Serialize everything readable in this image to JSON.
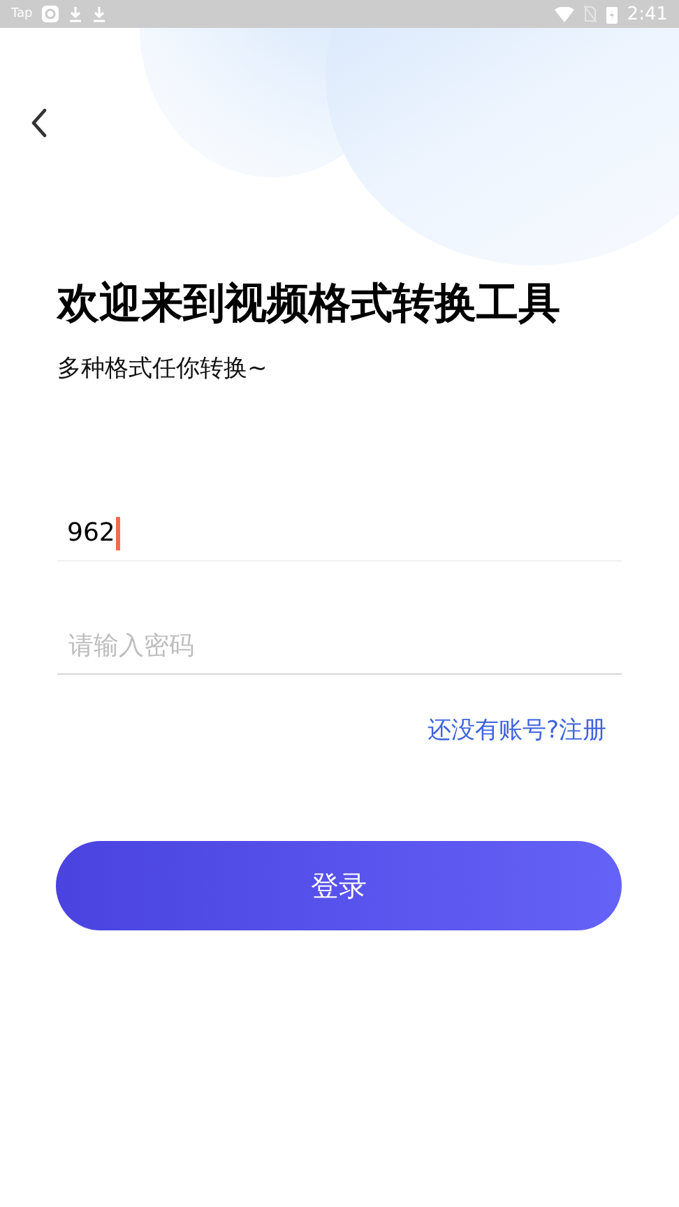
{
  "status_bar": {
    "carrier": "Tap",
    "time": "2:41"
  },
  "title": "欢迎来到视频格式转换工具",
  "subtitle": "多种格式任你转换~",
  "username": {
    "value": "962",
    "focused": true
  },
  "password": {
    "placeholder": "请输入密码"
  },
  "register_link": "还没有账号?注册",
  "login_button": "登录"
}
